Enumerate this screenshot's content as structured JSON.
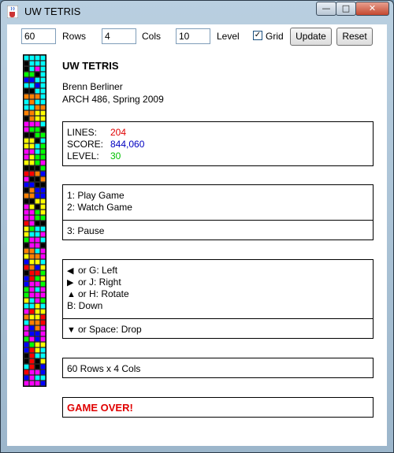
{
  "window": {
    "title": "UW TETRIS",
    "min_glyph": "—",
    "max_glyph": "□",
    "close_glyph": "✕"
  },
  "toolbar": {
    "rows_value": "60",
    "rows_label": "Rows",
    "cols_value": "4",
    "cols_label": "Cols",
    "level_value": "10",
    "level_label": "Level",
    "grid_checked": true,
    "grid_check_glyph": "✓",
    "grid_label": "Grid",
    "update_label": "Update",
    "reset_label": "Reset"
  },
  "info": {
    "title": "UW TETRIS",
    "author": "Brenn Berliner",
    "course": "ARCH 486, Spring 2009"
  },
  "stats": {
    "lines_label": "LINES:",
    "lines_value": "204",
    "score_label": "SCORE:",
    "score_value": "844,060",
    "level_label": "LEVEL:",
    "level_value": "30",
    "colors": {
      "lines": "#e00000",
      "score": "#0000c0",
      "level": "#00c000"
    }
  },
  "menu": {
    "play": "1:  Play Game",
    "watch": "2:  Watch Game",
    "pause": "3:  Pause"
  },
  "controls": {
    "left_key": "or  G:  Left",
    "right_key": "or  J:  Right",
    "rotate_key": "or  H:  Rotate",
    "down": "B:  Down",
    "drop_key": "or  Space:  Drop",
    "left_icon": "◀",
    "right_icon": "▶",
    "up_icon": "▲",
    "down_icon": "▼"
  },
  "board_info": "60 Rows x 4 Cols",
  "status": {
    "text": "GAME OVER!",
    "color": "#e00000"
  },
  "board": {
    "rows": 60,
    "cols": 4,
    "palette": [
      "#000000",
      "#00ffff",
      "#ff00ff",
      "#00ff00",
      "#ff0000",
      "#ffff00",
      "#0000ff",
      "#ff8000"
    ],
    "cells": [
      "1111",
      "0111",
      "0121",
      "3301",
      "6611",
      "1161",
      "0011",
      "7771",
      "1711",
      "1177",
      "7755",
      "0755",
      "2221",
      "2330",
      "0033",
      "5501",
      "5513",
      "2213",
      "2533",
      "5532",
      "0003",
      "4476",
      "2007",
      "6600",
      "0766",
      "7766",
      "0055",
      "2505",
      "2235",
      "2233",
      "4200",
      "5311",
      "5112",
      "3221",
      "0220",
      "7712",
      "5772",
      "6551",
      "4765",
      "0443",
      "6435",
      "6223",
      "3212",
      "3222",
      "5123",
      "1151",
      "2455",
      "7554",
      "1774",
      "2672",
      "2662",
      "3262",
      "6355",
      "6451",
      "0411",
      "0405",
      "1406",
      "4226",
      "6211",
      "2226"
    ]
  }
}
